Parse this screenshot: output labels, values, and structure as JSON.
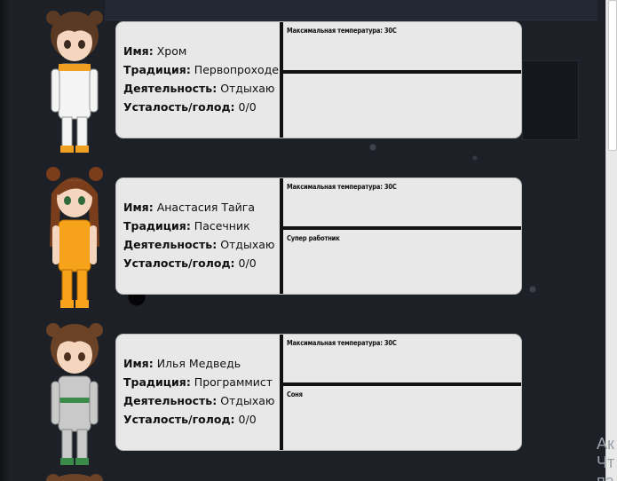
{
  "labels": {
    "name": "Имя:",
    "tradition": "Традиция:",
    "activity": "Деятельность:",
    "fatigue": "Усталость/голод:"
  },
  "characters": [
    {
      "name": "Хром",
      "tradition": "Первопроходец",
      "activity": "Отдыхаю",
      "fatigue": "0/0",
      "trait1": "Максимальная температура: 30С",
      "trait2": "",
      "hair_color": "#5a3a22",
      "suit_color": "#f4f4f4",
      "accent_color": "#f0a020"
    },
    {
      "name": "Анастасия Тайга",
      "tradition": "Пасечник",
      "activity": "Отдыхаю",
      "fatigue": "0/0",
      "trait1": "Максимальная температура: 30С",
      "trait2": "Супер работник",
      "hair_color": "#7a3e1c",
      "suit_color": "#f6a21a",
      "accent_color": "#f6a21a"
    },
    {
      "name": "Илья Медведь",
      "tradition": "Программист",
      "activity": "Отдыхаю",
      "fatigue": "0/0",
      "trait1": "Максимальная температура: 30С",
      "trait2": "Соня",
      "hair_color": "#6b4226",
      "suit_color": "#c9c9c9",
      "accent_color": "#3a8a4a"
    }
  ],
  "watermark": "Ак\nЧт\nпа"
}
